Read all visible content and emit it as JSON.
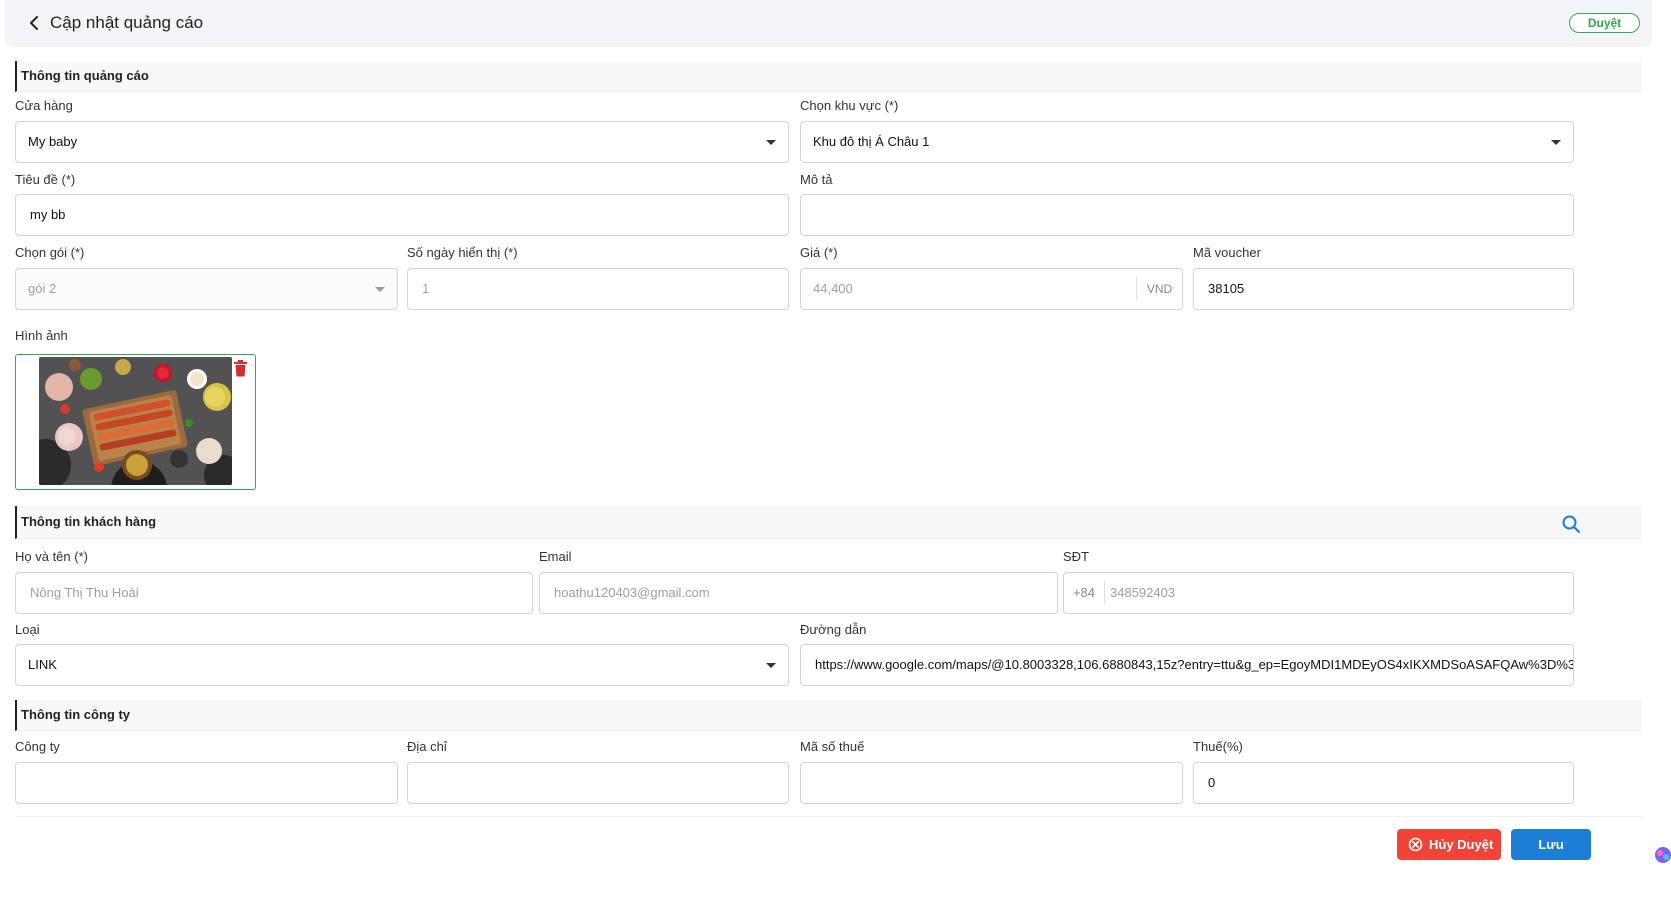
{
  "header": {
    "title": "Cập nhật quảng cáo",
    "status_badge": "Duyệt"
  },
  "sections": {
    "ad_info": "Thông tin quảng cáo",
    "customer_info": "Thông tin khách hàng",
    "company_info": "Thông tin công ty"
  },
  "ad": {
    "store_label": "Cửa hàng",
    "store_value": "My baby",
    "area_label": "Chọn khu vực (*)",
    "area_value": "Khu đô thị  Á Châu 1",
    "title_label": "Tiêu đề (*)",
    "title_value": "my bb",
    "desc_label": "Mô tả",
    "desc_value": "",
    "package_label": "Chọn gói (*)",
    "package_value": "gói 2",
    "days_label": "Số ngày hiển thị (*)",
    "days_value": "1",
    "price_label": "Giá (*)",
    "price_value": "44,400",
    "price_unit": "VND",
    "voucher_label": "Mã voucher",
    "voucher_value": "38105",
    "image_label": "Hình ảnh"
  },
  "customer": {
    "name_label": "Họ và tên (*)",
    "name_value": "Nông Thị Thu Hoài",
    "email_label": "Email",
    "email_value": "hoathu120403@gmail.com",
    "phone_label": "SĐT",
    "phone_prefix": "+84",
    "phone_value": "348592403",
    "type_label": "Loại",
    "type_value": "LINK",
    "link_label": "Đường dẫn",
    "link_value": "https://www.google.com/maps/@10.8003328,106.6880843,15z?entry=ttu&g_ep=EgoyMDI1MDEyOS4xIKXMDSoASAFQAw%3D%3"
  },
  "company": {
    "company_label": "Công ty",
    "company_value": "",
    "address_label": "Địa chỉ",
    "address_value": "",
    "tax_code_label": "Mã số thuế",
    "tax_code_value": "",
    "tax_label": "Thuế(%)",
    "tax_value": "0"
  },
  "actions": {
    "cancel_label": "Hủy Duyệt",
    "save_label": "Lưu"
  },
  "colors": {
    "accent": "#1d7ed6",
    "danger": "#f04438",
    "success": "#34a853"
  },
  "icons": [
    "chevron-left-icon",
    "trash-icon",
    "search-icon",
    "cancel-circle-icon"
  ]
}
